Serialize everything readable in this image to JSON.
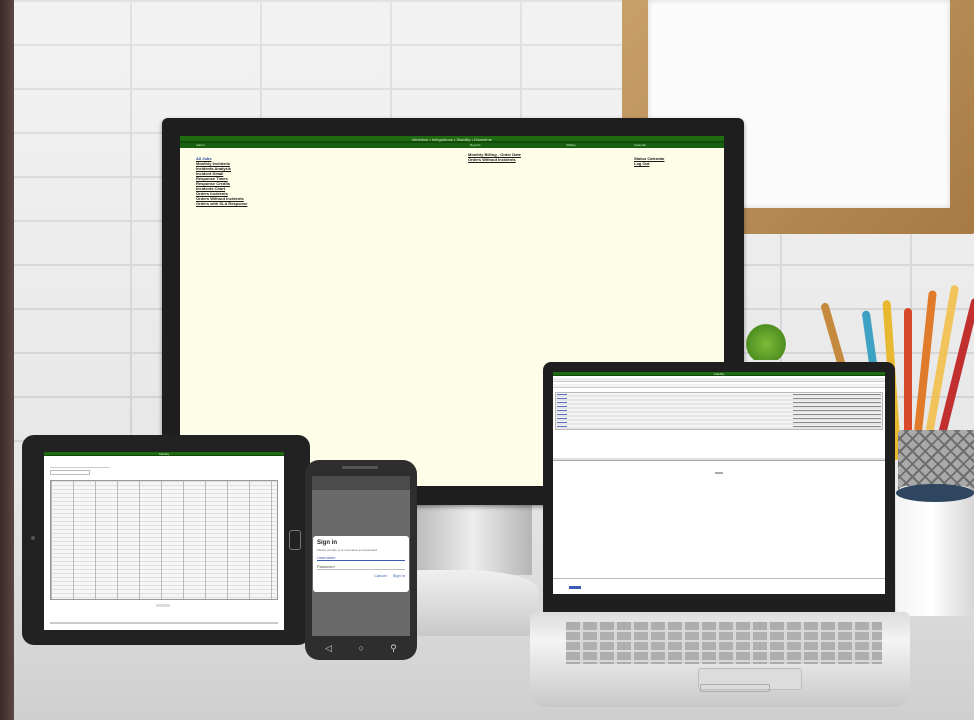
{
  "scene": {
    "description_visible_text": "",
    "colors": {
      "wall": "#ececec",
      "desk": "#d9d9d9",
      "app_header_green": "#1f6b12",
      "monitor_bg": "#fdfde8"
    }
  },
  "monitor": {
    "header_title": "Metrolink • Integrations • Stability • Downtime",
    "column_headers": [
      "Admin",
      "Reports",
      "Utilities",
      "Calendar"
    ],
    "left_links": [
      "All Jobs",
      "Monthly Incidents",
      "Incidents Analysis",
      "Incident Detail",
      "Response Times",
      "Response Credits",
      "Incidents Chart",
      "Orders Incidents",
      "Orders Without Incidents",
      "Orders with SLA Response"
    ],
    "middle_links": [
      "Monthly Billing - Order Date",
      "Orders Without Incidents"
    ],
    "right_links": [
      "Status Calendar",
      "Log Out"
    ]
  },
  "phone": {
    "signin_title": "Sign in",
    "signin_text": "Please provide your username and password",
    "username_label": "Username",
    "password_label": "Password",
    "cancel_label": "Cancel",
    "signin_button": "Sign in"
  },
  "tablet": {
    "header_title": "Stability"
  },
  "laptop": {
    "header_title": "Stability"
  },
  "icons": {
    "phone_nav": [
      "back-icon",
      "home-icon",
      "search-icon"
    ]
  }
}
